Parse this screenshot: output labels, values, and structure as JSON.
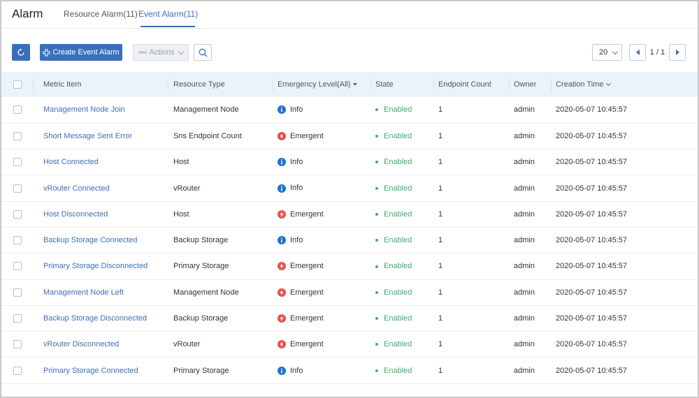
{
  "header": {
    "title": "Alarm",
    "tabs": [
      {
        "label": "Resource Alarm(11)",
        "active": false
      },
      {
        "label": "Event Alarm(11)",
        "active": true
      }
    ]
  },
  "toolbar": {
    "create_label": "Create Event Alarm",
    "actions_label": "Actions",
    "page_size": "20",
    "page_indicator": "1 / 1"
  },
  "table": {
    "columns": [
      "Metric Item",
      "Resource Type",
      "Emergency Level(All)",
      "State",
      "Endpoint Count",
      "Owner",
      "Creation Time"
    ],
    "rows": [
      {
        "metric": "Management Node Join",
        "resource": "Management Node",
        "level": "Info",
        "state": "Enabled",
        "count": "1",
        "owner": "admin",
        "time": "2020-05-07 10:45:57"
      },
      {
        "metric": "Short Message Sent Error",
        "resource": "Sns Endpoint Count",
        "level": "Emergent",
        "state": "Enabled",
        "count": "1",
        "owner": "admin",
        "time": "2020-05-07 10:45:57"
      },
      {
        "metric": "Host Connected",
        "resource": "Host",
        "level": "Info",
        "state": "Enabled",
        "count": "1",
        "owner": "admin",
        "time": "2020-05-07 10:45:57"
      },
      {
        "metric": "vRouter Connected",
        "resource": "vRouter",
        "level": "Info",
        "state": "Enabled",
        "count": "1",
        "owner": "admin",
        "time": "2020-05-07 10:45:57"
      },
      {
        "metric": "Host Disconnected",
        "resource": "Host",
        "level": "Emergent",
        "state": "Enabled",
        "count": "1",
        "owner": "admin",
        "time": "2020-05-07 10:45:57"
      },
      {
        "metric": "Backup Storage Connected",
        "resource": "Backup Storage",
        "level": "Info",
        "state": "Enabled",
        "count": "1",
        "owner": "admin",
        "time": "2020-05-07 10:45:57"
      },
      {
        "metric": "Primary Storage Disconnected",
        "resource": "Primary Storage",
        "level": "Emergent",
        "state": "Enabled",
        "count": "1",
        "owner": "admin",
        "time": "2020-05-07 10:45:57"
      },
      {
        "metric": "Management Node Left",
        "resource": "Management Node",
        "level": "Emergent",
        "state": "Enabled",
        "count": "1",
        "owner": "admin",
        "time": "2020-05-07 10:45:57"
      },
      {
        "metric": "Backup Storage Disconnected",
        "resource": "Backup Storage",
        "level": "Emergent",
        "state": "Enabled",
        "count": "1",
        "owner": "admin",
        "time": "2020-05-07 10:45:57"
      },
      {
        "metric": "vRouter Disconnected",
        "resource": "vRouter",
        "level": "Emergent",
        "state": "Enabled",
        "count": "1",
        "owner": "admin",
        "time": "2020-05-07 10:45:57"
      },
      {
        "metric": "Primary Storage Connected",
        "resource": "Primary Storage",
        "level": "Info",
        "state": "Enabled",
        "count": "1",
        "owner": "admin",
        "time": "2020-05-07 10:45:57"
      }
    ]
  },
  "colors": {
    "accent": "#3b6fbc",
    "info": "#1e73cf",
    "emergent": "#e5514f",
    "enabled": "#3fae6e",
    "header_bg": "#eaf3fc"
  },
  "icons": {
    "refresh": "refresh-icon",
    "create": "plus-icon",
    "actions": "more-dots-icon",
    "search": "search-icon",
    "info": "info-icon",
    "emergent": "lightning-icon"
  }
}
